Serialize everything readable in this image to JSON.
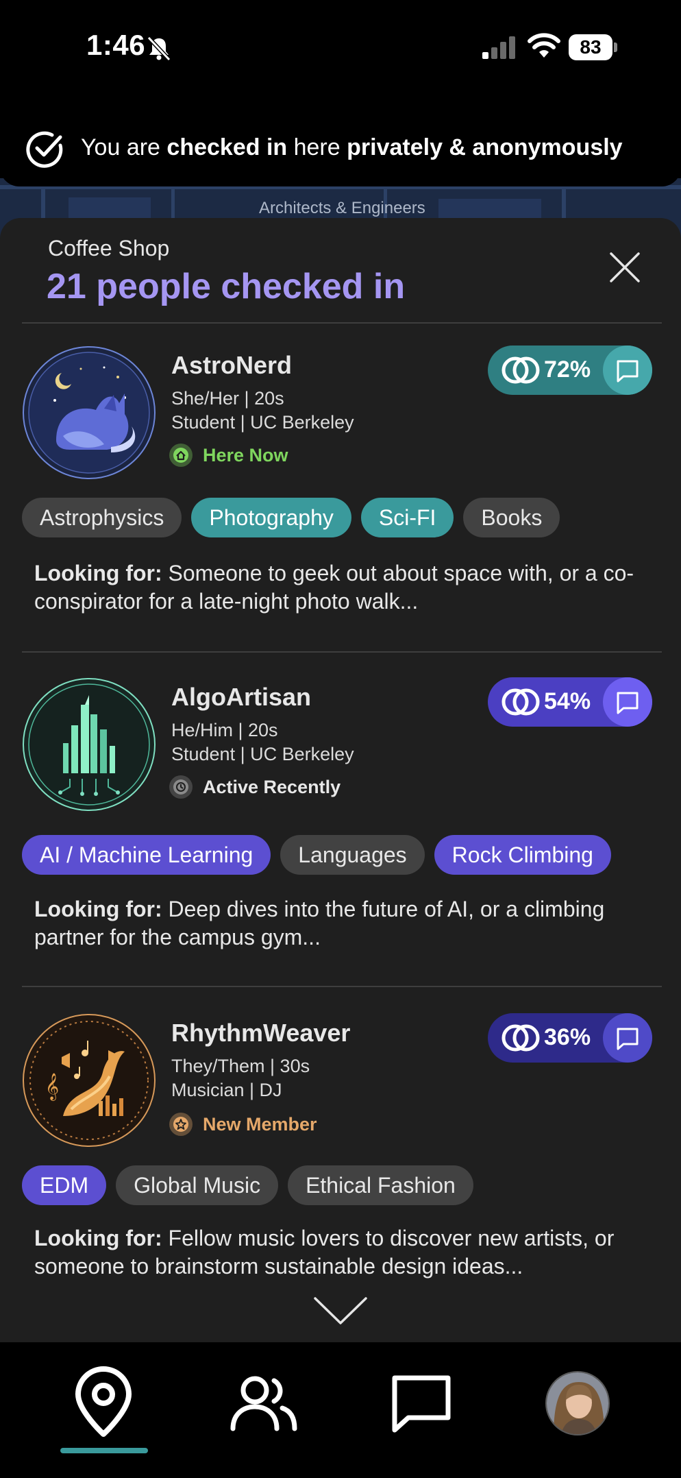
{
  "status_bar": {
    "time": "1:46",
    "battery": "83"
  },
  "banner": {
    "prefix": "You are ",
    "bold1": "checked in",
    "mid": " here ",
    "bold2": "privately & anonymously"
  },
  "map": {
    "label": "Architects & Engineers"
  },
  "sheet": {
    "subtitle": "Coffee Shop",
    "title": "21 people checked in"
  },
  "colors": {
    "teal": "#3a9a9c",
    "violet": "#5c4fd1",
    "title_purple": "#a596f2",
    "here_now_green": "#7fd65e",
    "new_member_gold": "#e5a86a"
  },
  "looking_label": "Looking for:",
  "people": [
    {
      "name": "AstroNerd",
      "line1": "She/Her | 20s",
      "line2": "Student | UC Berkeley",
      "status": "Here Now",
      "status_icon": "home-icon",
      "match": "72%",
      "tags": [
        "Astrophysics",
        "Photography",
        "Sci-FI",
        "Books"
      ],
      "looking": "Someone to geek out about space with, or a co-conspirator for a late-night photo walk..."
    },
    {
      "name": "AlgoArtisan",
      "line1": "He/Him | 20s",
      "line2": "Student | UC Berkeley",
      "status": "Active Recently",
      "status_icon": "clock-icon",
      "match": "54%",
      "tags": [
        "AI / Machine Learning",
        "Languages",
        "Rock Climbing"
      ],
      "looking": "Deep dives into the future of AI, or a climbing partner for the campus gym..."
    },
    {
      "name": "RhythmWeaver",
      "line1": "They/Them | 30s",
      "line2": "Musician | DJ",
      "status": "New Member",
      "status_icon": "star-icon",
      "match": "36%",
      "tags": [
        "EDM",
        "Global Music",
        "Ethical Fashion"
      ],
      "looking": "Fellow music lovers to discover new artists, or someone to brainstorm sustainable design ideas..."
    }
  ],
  "nav": {
    "items": [
      "map-pin-icon",
      "people-icon",
      "chat-icon",
      "profile-avatar"
    ],
    "active": "map-pin-icon"
  }
}
